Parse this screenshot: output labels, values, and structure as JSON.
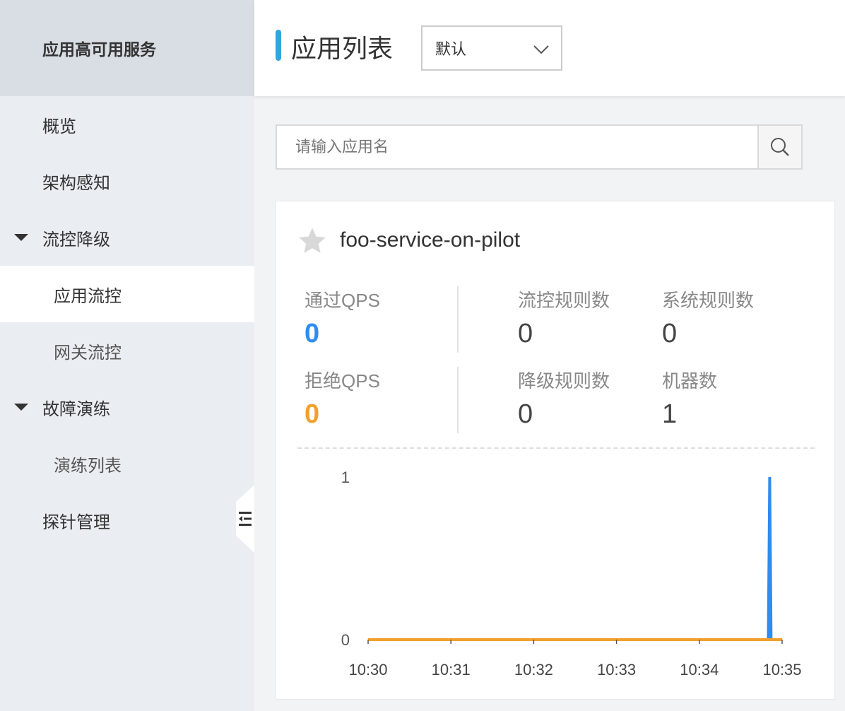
{
  "sidebar": {
    "header": "应用高可用服务",
    "items": [
      {
        "label": "概览"
      },
      {
        "label": "架构感知"
      },
      {
        "label": "流控降级"
      },
      {
        "label": "应用流控"
      },
      {
        "label": "网关流控"
      },
      {
        "label": "故障演练"
      },
      {
        "label": "演练列表"
      },
      {
        "label": "探针管理"
      }
    ],
    "collapse_icon": "collapse-sidebar-icon"
  },
  "header": {
    "title": "应用列表",
    "select_value": "默认"
  },
  "search": {
    "placeholder": "请输入应用名",
    "icon": "search-icon"
  },
  "card": {
    "app_name": "foo-service-on-pilot",
    "stats": {
      "pass_qps_label": "通过QPS",
      "pass_qps_value": "0",
      "block_qps_label": "拒绝QPS",
      "block_qps_value": "0",
      "flow_rules_label": "流控规则数",
      "flow_rules_value": "0",
      "system_rules_label": "系统规则数",
      "system_rules_value": "0",
      "degrade_rules_label": "降级规则数",
      "degrade_rules_value": "0",
      "machines_label": "机器数",
      "machines_value": "1"
    }
  },
  "colors": {
    "accent": "#2da7e0",
    "pass": "#2d8cf0",
    "block": "#f0a12d"
  },
  "chart_data": {
    "type": "line",
    "x_ticks": [
      "10:30",
      "10:31",
      "10:32",
      "10:33",
      "10:34",
      "10:35"
    ],
    "y_ticks": [
      "0",
      "1"
    ],
    "ylim": [
      0,
      1
    ],
    "series": [
      {
        "color": "#2d8cf0",
        "points": [
          [
            "10:30",
            0
          ],
          [
            "10:34:50",
            0
          ],
          [
            "10:34:51",
            1
          ],
          [
            "10:34:52",
            0
          ]
        ]
      },
      {
        "color": "#f0a12d",
        "points": [
          [
            "10:30",
            0
          ],
          [
            "10:35",
            0
          ]
        ]
      }
    ]
  }
}
